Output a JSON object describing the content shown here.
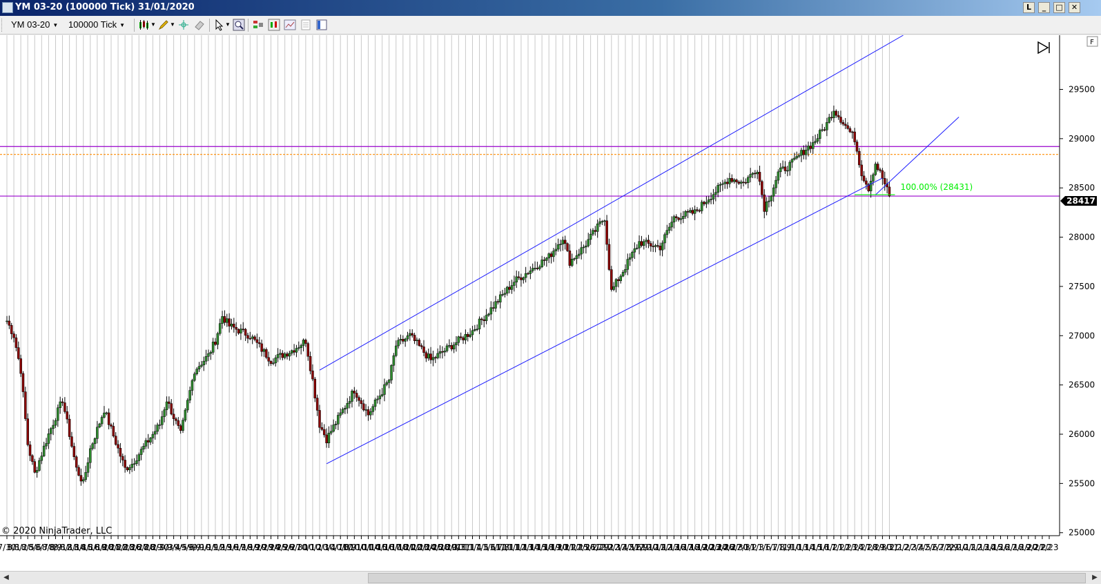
{
  "window": {
    "title": "YM 03-20 (100000 Tick)  31/01/2020",
    "buttons": [
      "L",
      "_",
      "□",
      "✕"
    ]
  },
  "toolbar": {
    "instrument": "YM 03-20",
    "interval": "100000 Tick",
    "icons": [
      "candlestick-style-icon",
      "pencil-draw-icon",
      "crosshair-icon",
      "eraser-icon",
      "pointer-icon",
      "zoom-icon",
      "strategy-icon",
      "indicator-icon",
      "properties-icon",
      "data-box-icon",
      "chart-trader-icon"
    ]
  },
  "chart": {
    "copyright": "© 2020 NinjaTrader, LLC",
    "panel_tag": "F",
    "fib_label": "100.00% (28431)",
    "last_price_label": "28417"
  },
  "chart_data": {
    "type": "candlestick",
    "ylim": [
      24970,
      30050
    ],
    "y_ticks": [
      "25000",
      "25500",
      "26000",
      "26500",
      "27000",
      "27500",
      "28000",
      "28500",
      "29000",
      "29500"
    ],
    "date_labels": [
      "7/30",
      "8/1",
      "8/2",
      "8/5",
      "8/6",
      "8/7",
      "8/8",
      "8/9",
      "8/12",
      "8/13",
      "8/14",
      "8/15",
      "8/16",
      "8/19",
      "8/20",
      "8/21",
      "8/22",
      "8/23",
      "8/26",
      "8/27",
      "8/28",
      "8/29",
      "8/30",
      "9/3",
      "9/4",
      "9/5",
      "9/6",
      "9/9",
      "9/10",
      "9/11",
      "9/12",
      "9/13",
      "9/16",
      "9/17",
      "9/18",
      "9/19",
      "9/20",
      "9/23",
      "9/24",
      "9/25",
      "9/26",
      "9/27",
      "9/30",
      "10/1",
      "10/2",
      "10/3",
      "10/4",
      "10/7",
      "10/8",
      "10/9",
      "10/10",
      "10/11",
      "10/14",
      "10/15",
      "10/16",
      "10/17",
      "10/18",
      "10/21",
      "10/22",
      "10/23",
      "10/24",
      "10/25",
      "10/28",
      "10/29",
      "10/30",
      "10/31",
      "11/1",
      "11/4",
      "11/5",
      "11/6",
      "11/7",
      "11/8",
      "11/11",
      "11/12",
      "11/13",
      "11/14",
      "11/15",
      "11/18",
      "11/19",
      "11/20",
      "11/21",
      "11/22",
      "11/25",
      "11/26",
      "11/27",
      "11/29",
      "12/2",
      "12/3",
      "12/4",
      "12/5",
      "12/6",
      "12/9",
      "12/10",
      "12/11",
      "12/12",
      "12/13",
      "12/16",
      "12/17",
      "12/18",
      "12/19",
      "12/20",
      "12/23",
      "12/24",
      "12/26",
      "12/27",
      "12/30",
      "12/31",
      "1/2",
      "1/3",
      "1/6",
      "1/7",
      "1/8",
      "1/9",
      "1/10",
      "1/13",
      "1/14",
      "1/15",
      "1/16",
      "1/17",
      "1/21",
      "1/22",
      "1/23",
      "1/24",
      "1/27",
      "1/28",
      "1/29",
      "1/30",
      "1/31",
      "2/1",
      "2/2",
      "2/3",
      "2/4",
      "2/5",
      "2/6",
      "2/7",
      "2/8",
      "2/9",
      "2/10",
      "2/11",
      "2/12",
      "2/13",
      "2/14",
      "2/15",
      "2/16",
      "2/17",
      "2/18",
      "2/19",
      "2/20",
      "2/21",
      "2/22",
      "2/23"
    ],
    "anchor_points": [
      {
        "date": "7/30",
        "close": 27150
      },
      {
        "date": "8/1",
        "close": 27000
      },
      {
        "date": "8/2",
        "close": 26650
      },
      {
        "date": "8/5",
        "close": 25900
      },
      {
        "date": "8/6",
        "close": 25600
      },
      {
        "date": "8/8",
        "close": 26000
      },
      {
        "date": "8/12",
        "close": 26350
      },
      {
        "date": "8/14",
        "close": 25650
      },
      {
        "date": "8/15",
        "close": 25500
      },
      {
        "date": "8/16",
        "close": 25850
      },
      {
        "date": "8/20",
        "close": 26250
      },
      {
        "date": "8/23",
        "close": 25650
      },
      {
        "date": "8/26",
        "close": 25700
      },
      {
        "date": "8/28",
        "close": 25900
      },
      {
        "date": "8/30",
        "close": 26100
      },
      {
        "date": "9/3",
        "close": 26350
      },
      {
        "date": "9/5",
        "close": 26000
      },
      {
        "date": "9/9",
        "close": 26650
      },
      {
        "date": "9/11",
        "close": 26800
      },
      {
        "date": "9/12",
        "close": 26950
      },
      {
        "date": "9/13",
        "close": 27200
      },
      {
        "date": "9/16",
        "close": 27100
      },
      {
        "date": "9/19",
        "close": 27000
      },
      {
        "date": "9/24",
        "close": 26750
      },
      {
        "date": "9/27",
        "close": 26850
      },
      {
        "date": "10/1",
        "close": 26950
      },
      {
        "date": "10/2",
        "close": 26550
      },
      {
        "date": "10/3",
        "close": 26100
      },
      {
        "date": "10/4",
        "close": 25950
      },
      {
        "date": "10/8",
        "close": 26200
      },
      {
        "date": "10/10",
        "close": 26450
      },
      {
        "date": "10/14",
        "close": 26200
      },
      {
        "date": "10/17",
        "close": 26550
      },
      {
        "date": "10/18",
        "close": 26900
      },
      {
        "date": "10/22",
        "close": 27000
      },
      {
        "date": "10/25",
        "close": 26750
      },
      {
        "date": "10/29",
        "close": 26850
      },
      {
        "date": "11/1",
        "close": 27000
      },
      {
        "date": "11/4",
        "close": 27050
      },
      {
        "date": "11/7",
        "close": 27300
      },
      {
        "date": "11/12",
        "close": 27550
      },
      {
        "date": "11/15",
        "close": 27700
      },
      {
        "date": "11/19",
        "close": 27800
      },
      {
        "date": "11/21",
        "close": 28000
      },
      {
        "date": "11/22",
        "close": 27750
      },
      {
        "date": "11/26",
        "close": 27900
      },
      {
        "date": "11/29",
        "close": 28100
      },
      {
        "date": "12/2",
        "close": 28200
      },
      {
        "date": "12/3",
        "close": 27450
      },
      {
        "date": "12/5",
        "close": 27700
      },
      {
        "date": "12/9",
        "close": 27950
      },
      {
        "date": "12/12",
        "close": 27900
      },
      {
        "date": "12/16",
        "close": 28200
      },
      {
        "date": "12/19",
        "close": 28250
      },
      {
        "date": "12/23",
        "close": 28400
      },
      {
        "date": "12/27",
        "close": 28600
      },
      {
        "date": "12/31",
        "close": 28550
      },
      {
        "date": "1/3",
        "close": 28700
      },
      {
        "date": "1/6",
        "close": 28300
      },
      {
        "date": "1/7",
        "close": 28450
      },
      {
        "date": "1/8",
        "close": 28650
      },
      {
        "date": "1/10",
        "close": 28750
      },
      {
        "date": "1/14",
        "close": 28900
      },
      {
        "date": "1/15",
        "close": 28950
      },
      {
        "date": "1/17",
        "close": 29150
      },
      {
        "date": "1/21",
        "close": 29300
      },
      {
        "date": "1/22",
        "close": 29200
      },
      {
        "date": "1/24",
        "close": 29000
      },
      {
        "date": "1/27",
        "close": 28650
      },
      {
        "date": "1/28",
        "close": 28500
      },
      {
        "date": "1/29",
        "close": 28750
      },
      {
        "date": "1/30",
        "close": 28600
      },
      {
        "date": "1/31",
        "close": 28417
      }
    ],
    "horizontal_lines": [
      {
        "price": 28920,
        "color": "#9900cc"
      },
      {
        "price": 28417,
        "color": "#9900cc"
      },
      {
        "price": 28840,
        "color": "#ff8c00",
        "style": "dashed"
      }
    ],
    "trend_channel": {
      "upper": {
        "from": {
          "date": "10/3",
          "price": 26650
        },
        "to": {
          "date": "2/2",
          "price": 30050
        }
      },
      "middle": {
        "from": {
          "date": "1/29",
          "price": 28430
        },
        "to": {
          "date": "2/10",
          "price": 29220
        }
      },
      "lower": {
        "from": {
          "date": "10/4",
          "price": 25700
        },
        "to": {
          "date": "1/30",
          "price": 28600
        }
      }
    },
    "fib_level": {
      "label": "100.00% (28431)",
      "price": 28431,
      "color": "#00ee00"
    }
  }
}
